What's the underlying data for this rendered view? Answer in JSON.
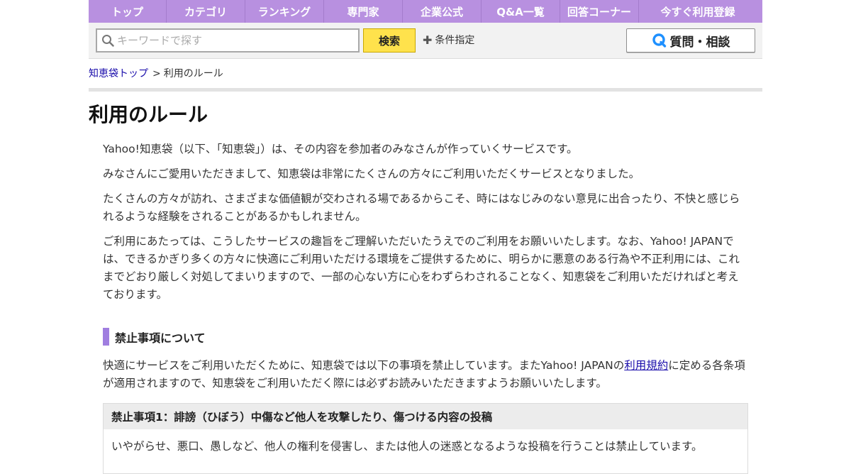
{
  "nav": {
    "items": [
      {
        "label": "トップ"
      },
      {
        "label": "カテゴリ"
      },
      {
        "label": "ランキング"
      },
      {
        "label": "専門家"
      },
      {
        "label": "企業公式"
      },
      {
        "label": "Q&A一覧"
      },
      {
        "label": "回答コーナー"
      },
      {
        "label": "今すぐ利用登録"
      }
    ]
  },
  "search": {
    "placeholder": "キーワードで探す",
    "value": "",
    "button_label": "検索",
    "conditions_label": "条件指定",
    "ask_button_label": "質問・相談"
  },
  "breadcrumb": {
    "home": "知恵袋トップ",
    "separator": ">",
    "current": "利用のルール"
  },
  "page": {
    "title": "利用のルール",
    "paragraphs": [
      "Yahoo!知恵袋（以下、「知恵袋」）は、その内容を参加者のみなさんが作っていくサービスです。",
      "みなさんにご愛用いただきまして、知恵袋は非常にたくさんの方々にご利用いただくサービスとなりました。",
      "たくさんの方々が訪れ、さまざまな価値観が交わされる場であるからこそ、時にはなじみのない意見に出合ったり、不快と感じられるような経験をされることがあるかもしれません。",
      "ご利用にあたっては、こうしたサービスの趣旨をご理解いただいたうえでのご利用をお願いいたします。なお、Yahoo! JAPANでは、できるかぎり多くの方々に快適にご利用いただける環境をご提供するために、明らかに悪意のある行為や不正利用には、これまでどおり厳しく対処してまいりますので、一部の心ない方に心をわずらわされることなく、知恵袋をご利用いただければと考えております。"
    ]
  },
  "section": {
    "heading": "禁止事項について",
    "body_before": "快適にサービスをご利用いただくために、知恵袋では以下の事項を禁止しています。またYahoo! JAPANの",
    "link_label": "利用規約",
    "body_after": "に定める各条項が適用されますので、知恵袋をご利用いただく際には必ずお読みいただきますようお願いいたします。"
  },
  "rule1": {
    "title": "禁止事項1：誹謗（ひぼう）中傷など他人を攻撃したり、傷つける内容の投稿",
    "text": "いやがらせ、悪口、愚しなど、他人の権利を侵害し、または他人の迷惑となるような投稿を行うことは禁止しています。"
  },
  "colors": {
    "nav_bg": "#b890e0",
    "accent_bar": "#a07ee0",
    "search_button": "#ffe24c",
    "link": "#1a0dab",
    "ask_icon": "#1e90ff"
  }
}
